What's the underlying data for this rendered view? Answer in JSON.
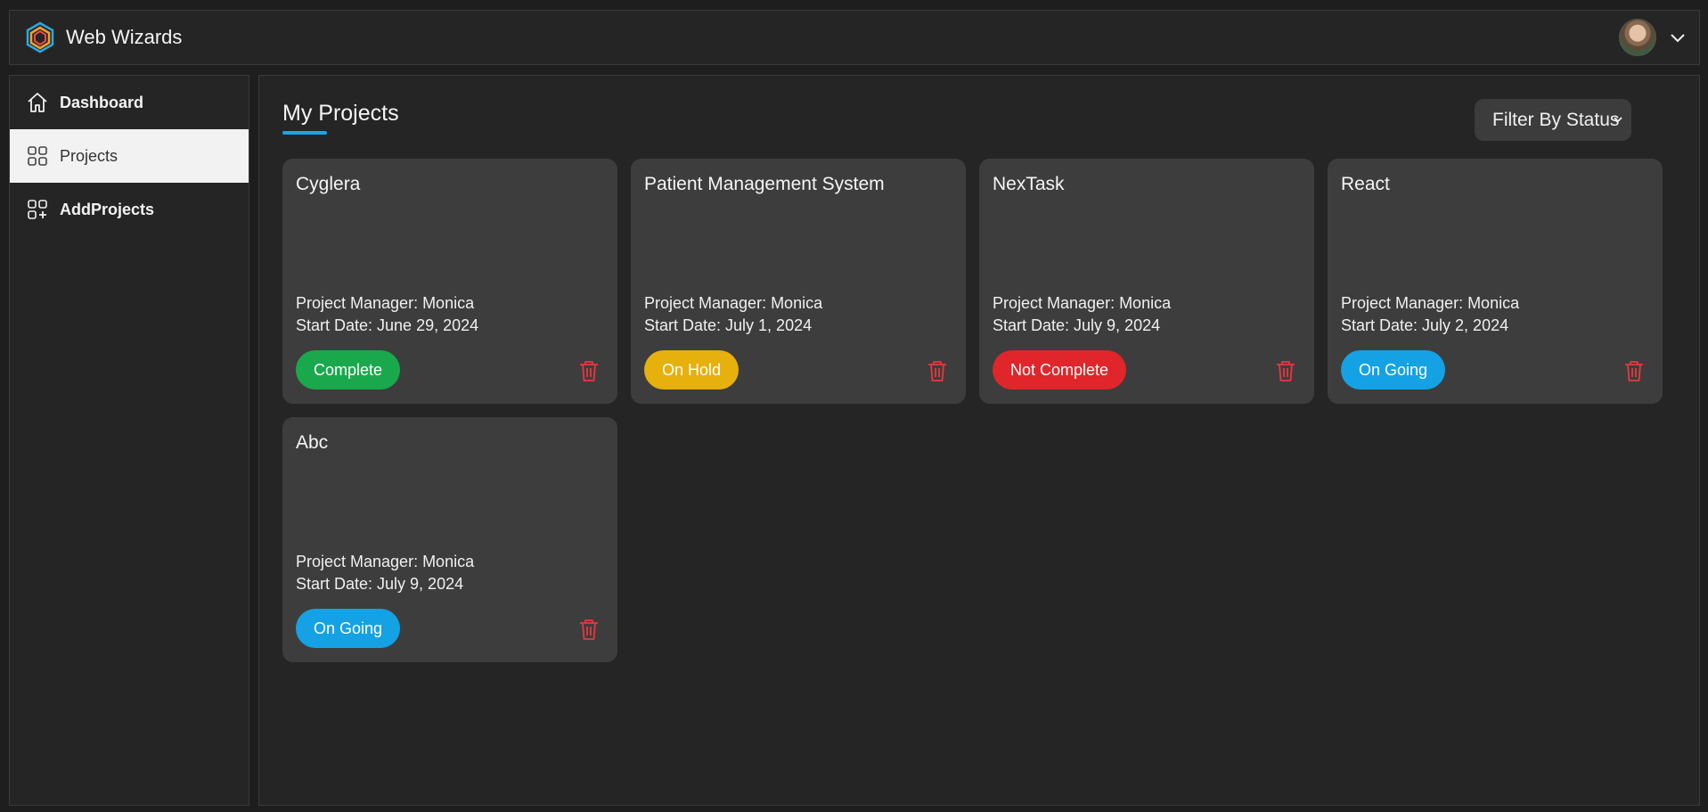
{
  "header": {
    "app_name": "Web Wizards"
  },
  "sidebar": {
    "items": [
      {
        "label": "Dashboard",
        "icon": "home-icon",
        "active": false
      },
      {
        "label": "Projects",
        "icon": "grid-icon",
        "active": true
      },
      {
        "label": "AddProjects",
        "icon": "grid-plus-icon",
        "active": false
      }
    ]
  },
  "main": {
    "title": "My Projects",
    "filter_label": "Filter By Status",
    "projects": [
      {
        "name": "Cyglera",
        "manager": "Project Manager: Monica",
        "start": "Start Date: June 29, 2024",
        "status": "Complete",
        "status_color": "#1aa84c"
      },
      {
        "name": "Patient Management System",
        "manager": "Project Manager: Monica",
        "start": "Start Date: July 1, 2024",
        "status": "On Hold",
        "status_color": "#e6b00d"
      },
      {
        "name": "NexTask",
        "manager": "Project Manager: Monica",
        "start": "Start Date: July 9, 2024",
        "status": "Not Complete",
        "status_color": "#e0262b"
      },
      {
        "name": "React",
        "manager": "Project Manager: Monica",
        "start": "Start Date: July 2, 2024",
        "status": "On Going",
        "status_color": "#14a2e4"
      },
      {
        "name": "Abc",
        "manager": "Project Manager: Monica",
        "start": "Start Date: July 9, 2024",
        "status": "On Going",
        "status_color": "#14a2e4"
      }
    ]
  },
  "colors": {
    "accent": "#1ea3e6",
    "delete": "#e5393e"
  }
}
